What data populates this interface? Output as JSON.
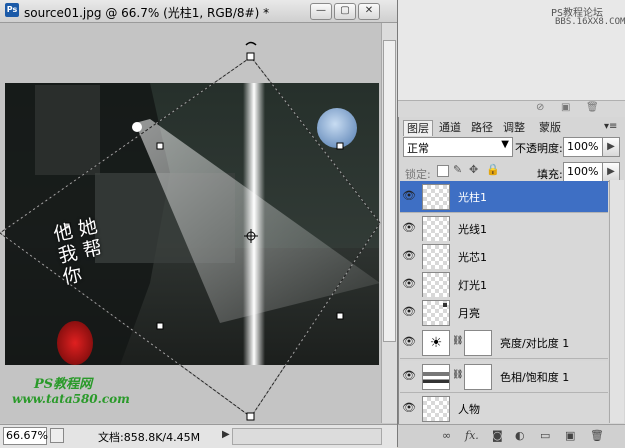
{
  "document": {
    "title": "source01.jpg @ 66.7% (光柱1, RGB/8#) *",
    "window_buttons": [
      "—",
      "▢",
      "✕"
    ],
    "overlay_text": {
      "calligraphy": [
        "他",
        "她",
        "我",
        "帮",
        "你"
      ],
      "site_name": "PS教程网",
      "site_url": "www.tata580.com"
    }
  },
  "status": {
    "zoom": "66.67%",
    "doc_size": "文档:858.8K/4.45M"
  },
  "watermark": {
    "line1": "PS教程论坛",
    "line2": "BBS.16XX8.COM"
  },
  "layers_panel": {
    "tabs": [
      "图层",
      "通道",
      "路径",
      "调整",
      "蒙版"
    ],
    "blend_mode": "正常",
    "opacity_label": "不透明度:",
    "opacity_value": "100%",
    "lock_label": "锁定:",
    "fill_label": "填充:",
    "fill_value": "100%",
    "layers": [
      {
        "name": "光柱1",
        "selected": true,
        "kind": "pixel"
      },
      {
        "name": "光线1",
        "selected": false,
        "kind": "pixel"
      },
      {
        "name": "光芯1",
        "selected": false,
        "kind": "pixel"
      },
      {
        "name": "灯光1",
        "selected": false,
        "kind": "pixel"
      },
      {
        "name": "月亮",
        "selected": false,
        "kind": "pixel"
      },
      {
        "name": "亮度/对比度 1",
        "selected": false,
        "kind": "adjustment",
        "icon": "sun-icon"
      },
      {
        "name": "色相/饱和度 1",
        "selected": false,
        "kind": "adjustment",
        "icon": "hue-saturation-icon"
      },
      {
        "name": "人物",
        "selected": false,
        "kind": "pixel"
      }
    ]
  },
  "colors": {
    "selection": "#3e6fc4",
    "panel_bg": "#d6d6d6",
    "moon": "#9ab8dc"
  }
}
